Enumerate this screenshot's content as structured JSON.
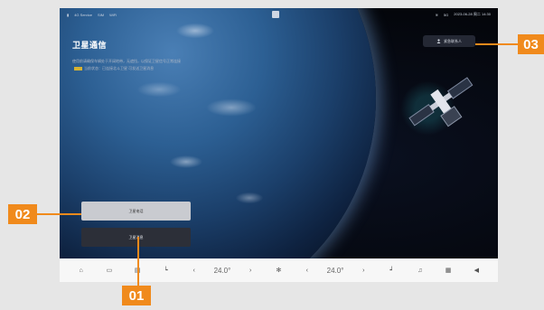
{
  "status_bar": {
    "left_items": [
      "4G Service",
      "SIM",
      "WiFi"
    ],
    "right_items": [
      "≋",
      "5G",
      "2023-06-28 周二 14:30"
    ]
  },
  "page": {
    "title": "卫星通信",
    "subtitle_lines": [
      "使用前请确保车辆处于开阔地带，无遮挡，以保证卫星信号正常连接",
      "当前状态：已连接北斗卫星 可发送卫星消息"
    ]
  },
  "account_pill": {
    "label": "紧急联系人",
    "icon": "person-icon"
  },
  "buttons": {
    "call": "卫星电话",
    "message": "卫星消息"
  },
  "dock": {
    "left_temp": "24.0°",
    "right_temp": "24.0°",
    "left_arrow_down": "‹",
    "left_arrow_up": "›",
    "right_arrow_down": "‹",
    "right_arrow_up": "›"
  },
  "callouts": {
    "one": "01",
    "two": "02",
    "three": "03"
  },
  "colors": {
    "accent": "#f08a1c",
    "screen_bg": "#06080f",
    "dock_bg": "#f7f7f7"
  }
}
